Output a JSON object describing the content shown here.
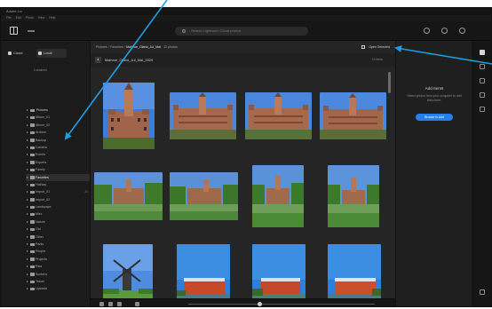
{
  "titlebar": {
    "app_name": "Adobe Lrc"
  },
  "menu": [
    "File",
    "Edit",
    "Photo",
    "View",
    "Help"
  ],
  "topbar": {
    "search_placeholder": "Search Lightroom Cloud photos"
  },
  "left_panel": {
    "tabs": [
      {
        "label": "Cloud",
        "icon": "cloud-icon"
      },
      {
        "label": "Local",
        "icon": "folder-icon",
        "active": true
      }
    ],
    "section_heading": "Locations",
    "tree": [
      {
        "label": "Pictures",
        "level": "root"
      },
      {
        "label": "Album_01"
      },
      {
        "label": "Album_02"
      },
      {
        "label": "Archive"
      },
      {
        "label": "Backup"
      },
      {
        "label": "Camera"
      },
      {
        "label": "Events"
      },
      {
        "label": "Exports"
      },
      {
        "label": "Family"
      },
      {
        "label": "Favorites",
        "selected": true
      },
      {
        "label": "Holiday"
      },
      {
        "label": "Import_01",
        "count": "24"
      },
      {
        "label": "Import_02"
      },
      {
        "label": "Landscape"
      },
      {
        "label": "Misc"
      },
      {
        "label": "Nature"
      },
      {
        "label": "Old"
      },
      {
        "label": "Other"
      },
      {
        "label": "Parks"
      },
      {
        "label": "People"
      },
      {
        "label": "Projects"
      },
      {
        "label": "Raw"
      },
      {
        "label": "Screens"
      },
      {
        "label": "Travel"
      },
      {
        "label": "Uploads"
      }
    ]
  },
  "center": {
    "breadcrumb": [
      "Pictures",
      "Favorites",
      "Malmoe_Oland_Jul_Mai"
    ],
    "breadcrumb_extra": "12 photos",
    "open_button": "Open Selected",
    "folder_title": "Malmoe_Oland_Jul_Mai_2020",
    "folder_info": "12 items",
    "thumbnails": [
      {
        "name": "photo-castle-tower"
      },
      {
        "name": "photo-castle-wide-1"
      },
      {
        "name": "photo-castle-wide-2"
      },
      {
        "name": "photo-castle-wide-3"
      },
      {
        "name": "photo-castle-park-1"
      },
      {
        "name": "photo-castle-park-2"
      },
      {
        "name": "photo-castle-park-3"
      },
      {
        "name": "photo-castle-park-4"
      },
      {
        "name": "photo-windmill"
      },
      {
        "name": "photo-red-building-1"
      },
      {
        "name": "photo-red-building-2"
      },
      {
        "name": "photo-red-building-3"
      }
    ]
  },
  "right_panel": {
    "title": "Add Items",
    "description": "Select photos from your computer to add them here.",
    "button": "Browse to Add"
  },
  "colors": {
    "accent": "#2680eb",
    "annotation_arrow": "#18a0e6",
    "background": "#1e1e1e"
  }
}
